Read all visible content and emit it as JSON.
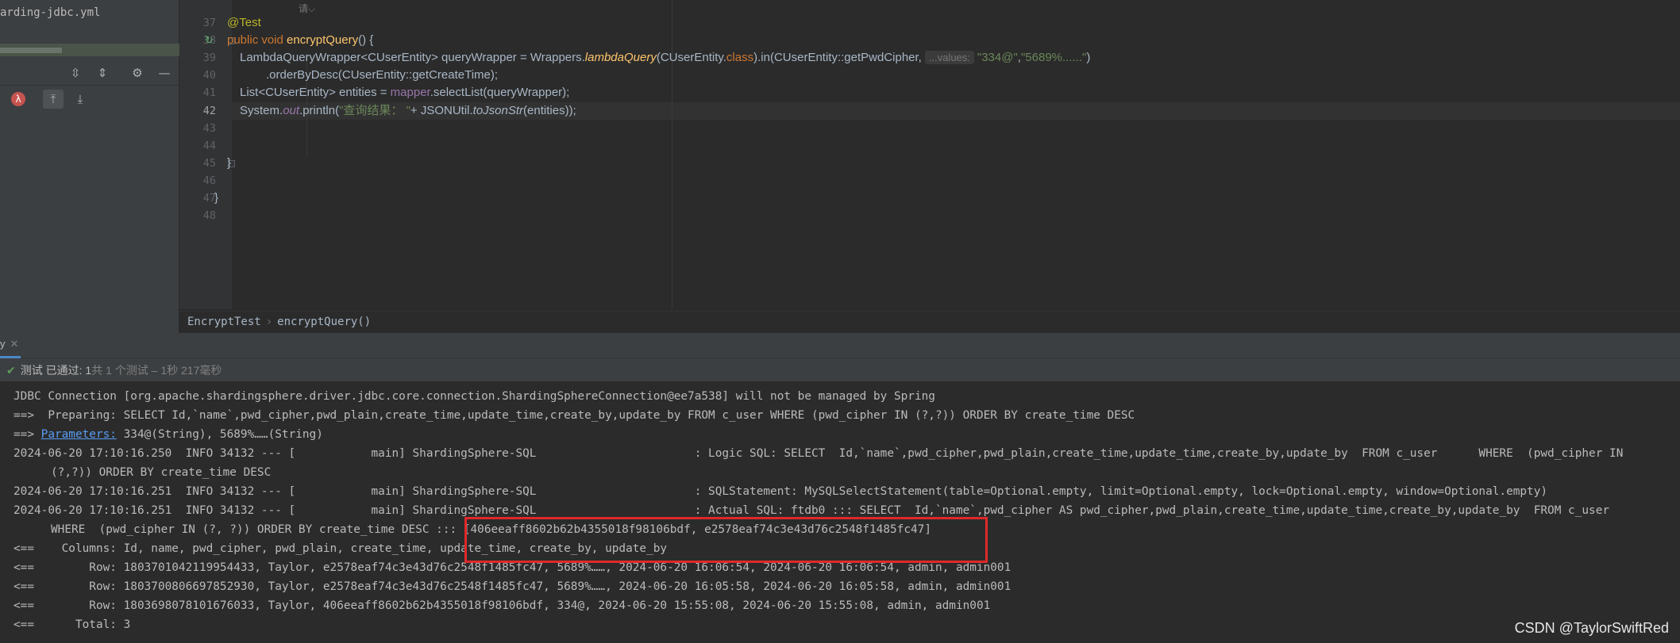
{
  "left_panel": {
    "file_item": "arding-jdbc.yml",
    "toolbar_icons": [
      "expand-all-icon",
      "collapse-all-icon",
      "gear-icon",
      "minimize-icon"
    ],
    "sort_icons": [
      "lambda-icon",
      "sort-up-icon",
      "sort-down-icon"
    ]
  },
  "editor": {
    "top_hint": "请⌵",
    "line_numbers": [
      "37",
      "38",
      "39",
      "40",
      "41",
      "42",
      "43",
      "44",
      "45",
      "46",
      "47",
      "48"
    ],
    "lines": {
      "l37_annotation": "@Test",
      "l38_public": "public void ",
      "l38_method": "encryptQuery",
      "l38_rest": "() {",
      "l39_a": "LambdaQueryWrapper",
      "l39_b": "<CUserEntity> queryWrapper = Wrappers.",
      "l39_c": "lambdaQuery",
      "l39_d": "(CUserEntity.",
      "l39_e": "class",
      "l39_f": ").in(CUserEntity::getPwdCipher,",
      "l39_hint": "...values:",
      "l39_g": "\"334@\"",
      "l39_h": ",",
      "l39_i": "\"5689%......\"",
      "l39_j": ")",
      "l40": ".orderByDesc(CUserEntity::getCreateTime);",
      "l41_a": "List<CUserEntity> entities = ",
      "l41_b": "mapper",
      "l41_c": ".selectList(queryWrapper);",
      "l42_a": "System.",
      "l42_b": "out",
      "l42_c": ".println(",
      "l42_d": "\"查询结果： \"",
      "l42_e": "+ JSONUtil.",
      "l42_f": "toJsonStr",
      "l42_g": "(entities));",
      "l45": "}",
      "l47": "}"
    }
  },
  "breadcrumb": {
    "class": "EncryptTest",
    "method": "encryptQuery()"
  },
  "run_panel": {
    "tab_label": "y",
    "status_label": "测试 已通过:",
    "status_count": " 1",
    "status_detail": "共 1 个测试 – 1秒 217毫秒"
  },
  "console": {
    "line1": "JDBC Connection [org.apache.shardingsphere.driver.jdbc.core.connection.ShardingSphereConnection@ee7a538] will not be managed by Spring",
    "line2": "==>  Preparing: SELECT Id,`name`,pwd_cipher,pwd_plain,create_time,update_time,create_by,update_by FROM c_user WHERE (pwd_cipher IN (?,?)) ORDER BY create_time DESC",
    "line3_prefix": "==> ",
    "line3_link": "Parameters:",
    "line3_rest": " 334@(String), 5689%……(String)",
    "line4": "2024-06-20 17:10:16.250  INFO 34132 --- [           main] ShardingSphere-SQL                       : Logic SQL: SELECT  Id,`name`,pwd_cipher,pwd_plain,create_time,update_time,create_by,update_by  FROM c_user      WHERE  (pwd_cipher IN",
    "line5": "(?,?)) ORDER BY create_time DESC",
    "line6": "2024-06-20 17:10:16.251  INFO 34132 --- [           main] ShardingSphere-SQL                       : SQLStatement: MySQLSelectStatement(table=Optional.empty, limit=Optional.empty, lock=Optional.empty, window=Optional.empty)",
    "line7": "2024-06-20 17:10:16.251  INFO 34132 --- [           main] ShardingSphere-SQL                       : Actual SQL: ftdb0 ::: SELECT  Id,`name`,pwd_cipher AS pwd_cipher,pwd_plain,create_time,update_time,create_by,update_by  FROM c_user",
    "line8": "WHERE  (pwd_cipher IN (?, ?)) ORDER BY create_time DESC ::: [406eeaff8602b62b4355018f98106bdf, e2578eaf74c3e43d76c2548f1485fc47]",
    "line9": "<==    Columns: Id, name, pwd_cipher, pwd_plain, create_time, update_time, create_by, update_by",
    "line10": "<==        Row: 1803701042119954433, Taylor, e2578eaf74c3e43d76c2548f1485fc47, 5689%……, 2024-06-20 16:06:54, 2024-06-20 16:06:54, admin, admin001",
    "line11": "<==        Row: 1803700806697852930, Taylor, e2578eaf74c3e43d76c2548f1485fc47, 5689%……, 2024-06-20 16:05:58, 2024-06-20 16:05:58, admin, admin001",
    "line12": "<==        Row: 1803698078101676033, Taylor, 406eeaff8602b62b4355018f98106bdf, 334@, 2024-06-20 15:55:08, 2024-06-20 15:55:08, admin, admin001",
    "line13": "<==      Total: 3"
  },
  "watermark": "CSDN @TaylorSwiftRed",
  "colors": {
    "accent_highlight": "#e0282b",
    "pass_green": "#5f9e5a",
    "link_blue": "#589df6"
  }
}
